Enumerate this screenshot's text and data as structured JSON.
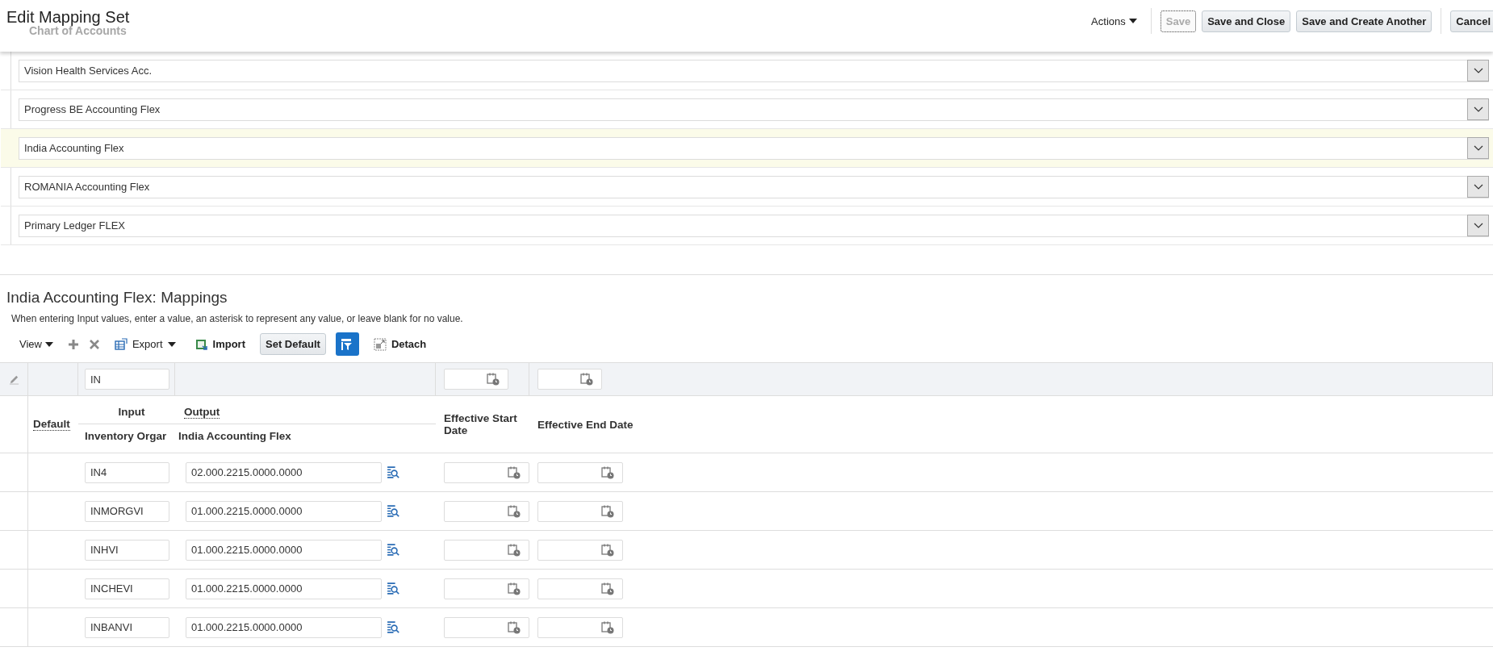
{
  "header": {
    "title": "Edit Mapping Set",
    "behind_label": "Chart of Accounts",
    "actions": "Actions",
    "buttons": [
      {
        "label": "Save",
        "disabled": true
      },
      {
        "label": "Save and Close",
        "disabled": false
      },
      {
        "label": "Save and Create Another",
        "disabled": false
      },
      {
        "label": "Cancel",
        "disabled": false
      }
    ]
  },
  "chart_of_accounts": [
    {
      "value": "Vision Health Services Acc.",
      "selected": false
    },
    {
      "value": "Progress BE Accounting Flex",
      "selected": false
    },
    {
      "value": "India Accounting Flex",
      "selected": true
    },
    {
      "value": "ROMANIA Accounting Flex",
      "selected": false
    },
    {
      "value": "Primary Ledger FLEX",
      "selected": false
    }
  ],
  "mappings": {
    "title": "India Accounting Flex: Mappings",
    "hint": "When entering Input values, enter a value, an asterisk to represent any value, or leave blank for no value.",
    "toolbar": {
      "view": "View",
      "export": "Export",
      "import": "Import",
      "set_default": "Set Default",
      "detach": "Detach"
    },
    "filter": {
      "input": "IN"
    },
    "columns": {
      "default": "Default",
      "input_group": "Input",
      "output_group": "Output",
      "input": "Inventory Orgar",
      "output": "India Accounting Flex",
      "start": "Effective Start Date",
      "end": "Effective End Date"
    },
    "rows": [
      {
        "input": "IN4",
        "output": "02.000.2215.0000.0000"
      },
      {
        "input": "INMORGVI",
        "output": "01.000.2215.0000.0000"
      },
      {
        "input": "INHVI",
        "output": "01.000.2215.0000.0000"
      },
      {
        "input": "INCHEVI",
        "output": "01.000.2215.0000.0000"
      },
      {
        "input": "INBANVI",
        "output": "01.000.2215.0000.0000"
      }
    ]
  }
}
